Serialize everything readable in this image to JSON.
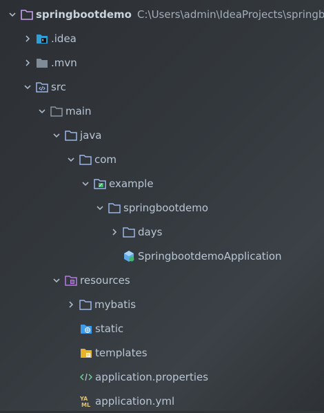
{
  "project": {
    "name": "springbootdemo",
    "path": "C:\\Users\\admin\\IdeaProjects\\springboo"
  },
  "tree": {
    "idea": ".idea",
    "mvn": ".mvn",
    "src": "src",
    "main": "main",
    "java": "java",
    "com": "com",
    "example": "example",
    "springbootdemo": "springbootdemo",
    "days": "days",
    "app_class": "SpringbootdemoApplication",
    "resources": "resources",
    "mybatis": "mybatis",
    "static": "static",
    "templates": "templates",
    "properties": "application.properties",
    "yml": "application.yml"
  },
  "colors": {
    "folder_blue": "#9bb6e8",
    "folder_gray": "#8a96a3",
    "resources_purple": "#b67ce3",
    "static_blue": "#3d9be9",
    "templates_yellow": "#e8b32b"
  }
}
